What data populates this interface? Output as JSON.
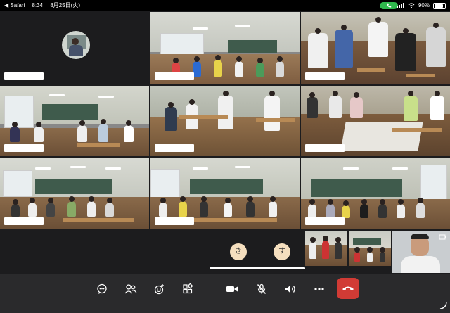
{
  "status_bar": {
    "back_label": "◀ Safari",
    "time": "8:34",
    "date": "8月25日(火)",
    "battery": "90%"
  },
  "participant_bubbles": [
    {
      "initial": "き"
    },
    {
      "initial": "す"
    }
  ],
  "toolbar": {
    "buttons": [
      "chat-icon",
      "participants-icon",
      "reactions-icon",
      "apps-icon",
      "camera-icon",
      "mic-muted-icon",
      "speaker-icon",
      "more-icon",
      "end-call-icon"
    ]
  }
}
